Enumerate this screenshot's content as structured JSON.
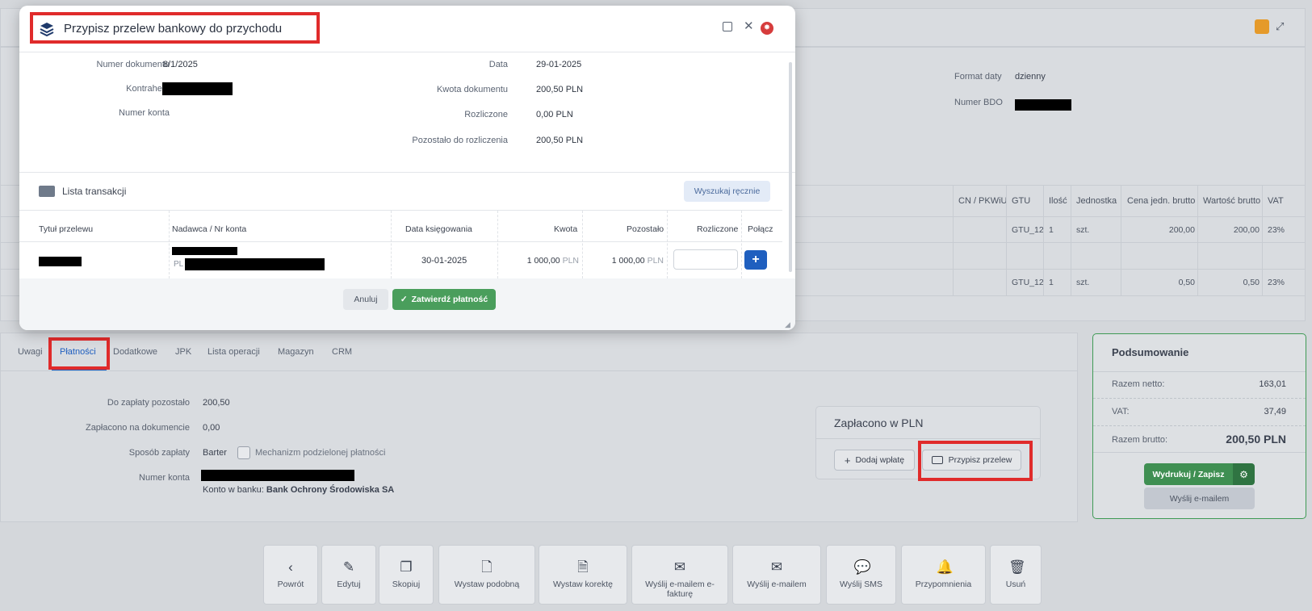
{
  "background": {
    "header_right": {
      "format_daty_label": "Format daty",
      "format_daty_value": "dzienny",
      "numer_bdo_label": "Numer BDO"
    },
    "items_table": {
      "headers": [
        "CN / PKWiU",
        "GTU",
        "Ilość",
        "Jednostka",
        "Cena jedn. brutto",
        "Wartość brutto",
        "VAT"
      ],
      "rows": [
        {
          "cn": "",
          "gtu": "GTU_12",
          "ilosc": "1",
          "jednostka": "szt.",
          "cena": "200,00",
          "wartosc": "200,00",
          "vat": "23%"
        },
        {
          "cn": "",
          "gtu": "GTU_12",
          "ilosc": "1",
          "jednostka": "szt.",
          "cena": "0,50",
          "wartosc": "0,50",
          "vat": "23%"
        }
      ]
    },
    "tabs": [
      "Uwagi",
      "Płatności",
      "Dodatkowe",
      "JPK",
      "Lista operacji",
      "Magazyn",
      "CRM"
    ],
    "payments": {
      "do_zaplaty_label": "Do zapłaty pozostało",
      "do_zaplaty_value": "200,50",
      "zaplacono_label": "Zapłacono na dokumencie",
      "zaplacono_value": "0,00",
      "sposob_label": "Sposób zapłaty",
      "sposob_value": "Barter",
      "mechanizm_label": "Mechanizm podzielonej płatności",
      "numer_konta_label": "Numer konta",
      "konto_prefix": "Konto w banku:",
      "bank_name": "Bank Ochrony Środowiska SA"
    },
    "paid_box": {
      "title": "Zapłacono w PLN",
      "dodaj_label": "Dodaj wpłatę",
      "przypisz_label": "Przypisz przelew"
    },
    "summary": {
      "title": "Podsumowanie",
      "netto_label": "Razem netto:",
      "netto_value": "163,01",
      "vat_label": "VAT:",
      "vat_value": "37,49",
      "brutto_label": "Razem brutto:",
      "brutto_value": "200,50 PLN",
      "print_label": "Wydrukuj / Zapisz",
      "email_label": "Wyślij e-mailem"
    },
    "actions": [
      {
        "icon": "chevron-left-icon",
        "label": "Powrót"
      },
      {
        "icon": "pencil-icon",
        "label": "Edytuj"
      },
      {
        "icon": "copy-icon",
        "label": "Skopiuj"
      },
      {
        "icon": "document-plus-icon",
        "label": "Wystaw podobną"
      },
      {
        "icon": "document-edit-icon",
        "label": "Wystaw korektę"
      },
      {
        "icon": "envelope-icon",
        "label": "Wyślij e-mailem e-fakturę"
      },
      {
        "icon": "envelope-icon",
        "label": "Wyślij e-mailem"
      },
      {
        "icon": "sms-icon",
        "label": "Wyślij SMS"
      },
      {
        "icon": "bell-icon",
        "label": "Przypomnienia"
      },
      {
        "icon": "trash-icon",
        "label": "Usuń"
      }
    ]
  },
  "modal": {
    "title": "Przypisz przelew bankowy do przychodu",
    "doc": {
      "numer_dokumentu_label": "Numer dokumentu",
      "numer_dokumentu_value": "8/1/2025",
      "kontrahent_label": "Kontrahent",
      "numer_konta_label": "Numer konta",
      "data_label": "Data",
      "data_value": "29-01-2025",
      "kwota_label": "Kwota dokumentu",
      "kwota_value": "200,50 PLN",
      "rozliczone_label": "Rozliczone",
      "rozliczone_value": "0,00 PLN",
      "pozostalo_label": "Pozostało do rozliczenia",
      "pozostalo_value": "200,50 PLN"
    },
    "transactions": {
      "title": "Lista transakcji",
      "search_label": "Wyszukaj ręcznie",
      "headers": {
        "tytul": "Tytuł przelewu",
        "nadawca": "Nadawca / Nr konta",
        "data": "Data księgowania",
        "kwota": "Kwota",
        "pozostalo": "Pozostało",
        "rozliczone": "Rozliczone",
        "polacz": "Połącz"
      },
      "row": {
        "account_prefix": "PL",
        "data": "30-01-2025",
        "kwota": "1 000,00",
        "kwota_currency": "PLN",
        "pozostalo": "1 000,00",
        "pozostalo_currency": "PLN",
        "rozliczone_value": ""
      }
    },
    "cancel_label": "Anuluj",
    "confirm_label": "Zatwierdź płatność",
    "colors": {
      "primary": "#1f5fbf",
      "success": "#4a9e5c",
      "danger": "#d63c3c"
    }
  }
}
